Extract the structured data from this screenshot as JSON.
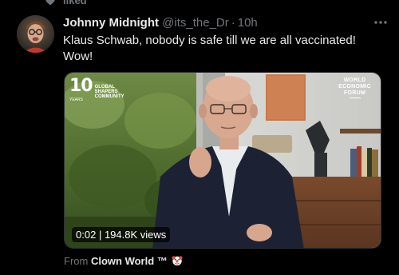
{
  "social_context": {
    "label": "liked",
    "icon": "heart-icon"
  },
  "tweet": {
    "author": {
      "display_name": "Johnny Midnight",
      "handle": "@its_the_Dr",
      "avatar_icon": "avatar"
    },
    "separator": "·",
    "timestamp": "10h",
    "text": "Klaus Schwab, nobody is safe till we are all vaccinated! Wow!",
    "more_icon": "more-dots-icon",
    "media": {
      "type": "video",
      "logo_left_number": "10",
      "logo_left_years": "YEARS",
      "logo_left_lines": [
        "GLOBAL",
        "SHAPERS",
        "COMMUNITY"
      ],
      "logo_right_lines": [
        "WORLD",
        "ECONOMIC",
        "FORUM"
      ],
      "duration": "0:02",
      "views_separator": "|",
      "views": "194.8K views"
    },
    "attribution": {
      "prefix": "From",
      "source": "Clown World ™",
      "source_icon": "clown-face-icon"
    }
  },
  "colors": {
    "background": "#000000",
    "primary_text": "#e7e9ea",
    "secondary_text": "#71767b",
    "border": "#2f3336"
  }
}
